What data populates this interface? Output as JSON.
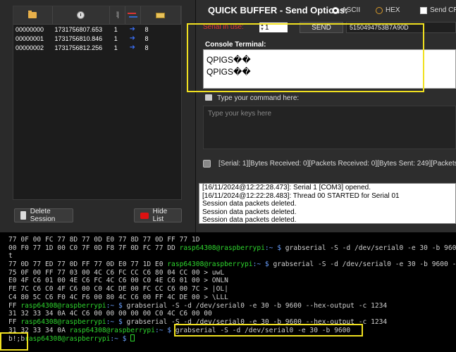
{
  "sessions": {
    "rows": [
      {
        "id": "00000000",
        "time": "1731756807.653",
        "serial": "1",
        "bytes": "8"
      },
      {
        "id": "00000001",
        "time": "1731756810.846",
        "serial": "1",
        "bytes": "8"
      },
      {
        "id": "00000002",
        "time": "1731756812.256",
        "serial": "1",
        "bytes": "8"
      }
    ],
    "arrow": "➜",
    "delete_label": "Delete Session",
    "hide_label": "Hide List"
  },
  "buffer": {
    "title": "QUICK BUFFER - Send Options:",
    "opt_ascii": "ASCII",
    "opt_hex": "HEX",
    "opt_cr": "Send CR",
    "serial_label": "Serial in use:",
    "serial_value": "1",
    "send_label": "SEND",
    "hex_value": "5150494753B7A90D"
  },
  "console": {
    "label": "Console Terminal:",
    "lines": [
      "QPIGS��",
      "QPIGS��"
    ]
  },
  "command": {
    "label": "Type your command here:",
    "placeholder": "Type your keys here"
  },
  "status": "[Serial: 1][Bytes Received: 0][Packets Received: 0][Bytes Sent: 249][Packets Sent",
  "log": [
    "[16/11/2024@12:22:28.473]: Serial 1 [COM3] opened.",
    "[16/11/2024@12:22:28.483]: Thread 00 STARTED for Serial 01",
    "Session data packets deleted.",
    "Session data packets deleted.",
    "Session data packets deleted."
  ],
  "terminal": {
    "prompt": "rasp64308@raspberrypi",
    "path": ":~ $",
    "lines": [
      {
        "pre": "77 0F 00 FC 77 8D 77 0D E0 77 8D 77 0D FF 77 1D",
        "prompt": false,
        "cmd": ""
      },
      {
        "pre": "00 F0 77 1D 00 C0 7F 0D F8 7F 0D FC 77 DD ",
        "prompt": true,
        "cmd": " grabserial -S -d /dev/serial0 -e 30 -b 960"
      },
      {
        "pre": "t",
        "prompt": false,
        "cmd": ""
      },
      {
        "pre": "77 0D 77 ED 77 0D FF 77 0D E0 77 1D E0 ",
        "prompt": true,
        "cmd": " grabserial -S -d /dev/serial0 -e 30 -b 9600 -"
      },
      {
        "pre": "75 0F 00 FF 77 03 00 4C C6 FC CC C6 80 04 CC 00 > uwL",
        "prompt": false,
        "cmd": ""
      },
      {
        "pre": "E0 4F C6 01 00 4E C6 FC 4C C6 00 C0 4E C6 01 00 > ONLN",
        "prompt": false,
        "cmd": ""
      },
      {
        "pre": "FE 7C C6 C0 4F C6 00 C0 4C DE 00 FC CC C6 00 7C > |OL|",
        "prompt": false,
        "cmd": ""
      },
      {
        "pre": "C4 80 5C C6 F0 4C F6 00 80 4C C6 00 FF 4C DE 00 > \\LLL",
        "prompt": false,
        "cmd": ""
      },
      {
        "pre": "FF ",
        "prompt": true,
        "cmd": " grabserial -S -d /dev/serial0 -e 30 -b 9600 --hex-output -c 1234"
      },
      {
        "pre": "31 32 33 34 0A 4C C6 00 00 00 00 00 C0 4C C6 00 00",
        "prompt": false,
        "cmd": ""
      },
      {
        "pre": "FF ",
        "prompt": true,
        "cmd": " grabserial -S -d /dev/serial0 -e 30 -b 9600 --hex-output -c 1234"
      },
      {
        "pre": "31 32 33 34 0A ",
        "prompt": true,
        "cmd": " grabserial -S -d /dev/serial0 -e 30 -b 9600"
      },
      {
        "pre": "b!;b",
        "prompt": true,
        "cmd": " "
      }
    ]
  }
}
